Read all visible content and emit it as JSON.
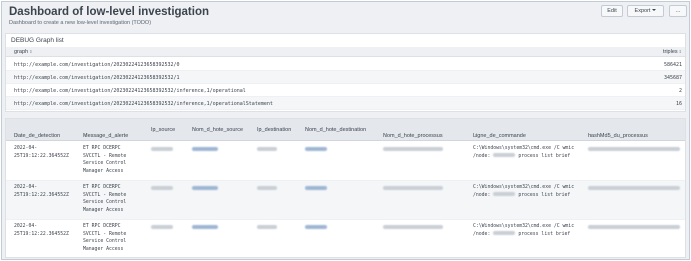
{
  "header": {
    "title": "Dashboard of low-level investigation",
    "subtitle": "Dashboard to create a new low-level investigation (TODO)",
    "edit_label": "Edit",
    "export_label": "Export",
    "more_label": "..."
  },
  "panel1": {
    "title": "DEBUG Graph list",
    "columns": {
      "graph": "graph",
      "triples": "triples"
    },
    "rows": [
      {
        "graph": "http://example.com/investigation/20230224123658392532/0",
        "triples": "586421"
      },
      {
        "graph": "http://example.com/investigation/20230224123658392532/1",
        "triples": "345687"
      },
      {
        "graph": "http://example.com/investigation/20230224123658392532/inference,1/operational",
        "triples": "2"
      },
      {
        "graph": "http://example.com/investigation/20230224123658392532/inference,1/operationalStatement",
        "triples": "16"
      }
    ]
  },
  "panel2": {
    "columns": {
      "date": "Date_de_detection",
      "message": "Message_d_alerte",
      "ip_source": "Ip_source",
      "hote_source": "Nom_d_hote_source",
      "ip_destination": "Ip_destination",
      "hote_destination": "Nom_d_hote_destination",
      "hote_processus": "Nom_d_hote_processus",
      "commande": "Ligne_de_commande",
      "hash": "hashMd5_du_processus"
    },
    "rows": [
      {
        "date_1": "2022-04-",
        "date_2": "25T19:12:22.364552Z",
        "msg_1": "ET RPC DCERPC",
        "msg_2": "SVCCTL - Remote",
        "msg_3": "Service Control",
        "msg_4": "Manager Access",
        "cmd_1": "C:\\Windows\\system32\\cmd.exe /C wmic",
        "cmd_2": "/node:",
        "cmd_3": "process list brief"
      },
      {
        "date_1": "2022-04-",
        "date_2": "25T19:12:22.364552Z",
        "msg_1": "ET RPC DCERPC",
        "msg_2": "SVCCTL - Remote",
        "msg_3": "Service Control",
        "msg_4": "Manager Access",
        "cmd_1": "C:\\Windows\\system32\\cmd.exe /C wmic",
        "cmd_2": "/node:",
        "cmd_3": "process list brief"
      },
      {
        "date_1": "2022-04-",
        "date_2": "25T19:12:22.364552Z",
        "msg_1": "ET RPC DCERPC",
        "msg_2": "SVCCTL - Remote",
        "msg_3": "Service Control",
        "msg_4": "Manager Access",
        "cmd_1": "C:\\Windows\\system32\\cmd.exe /C wmic",
        "cmd_2": "/node:",
        "cmd_3": "process list brief"
      }
    ]
  },
  "icons": {
    "sort": "sort-arrows-icon",
    "caret": "caret-down-icon"
  },
  "colors": {
    "background": "#eef0f3",
    "header_row": "#e4e8ec",
    "redacted": "#c9cfd6"
  }
}
